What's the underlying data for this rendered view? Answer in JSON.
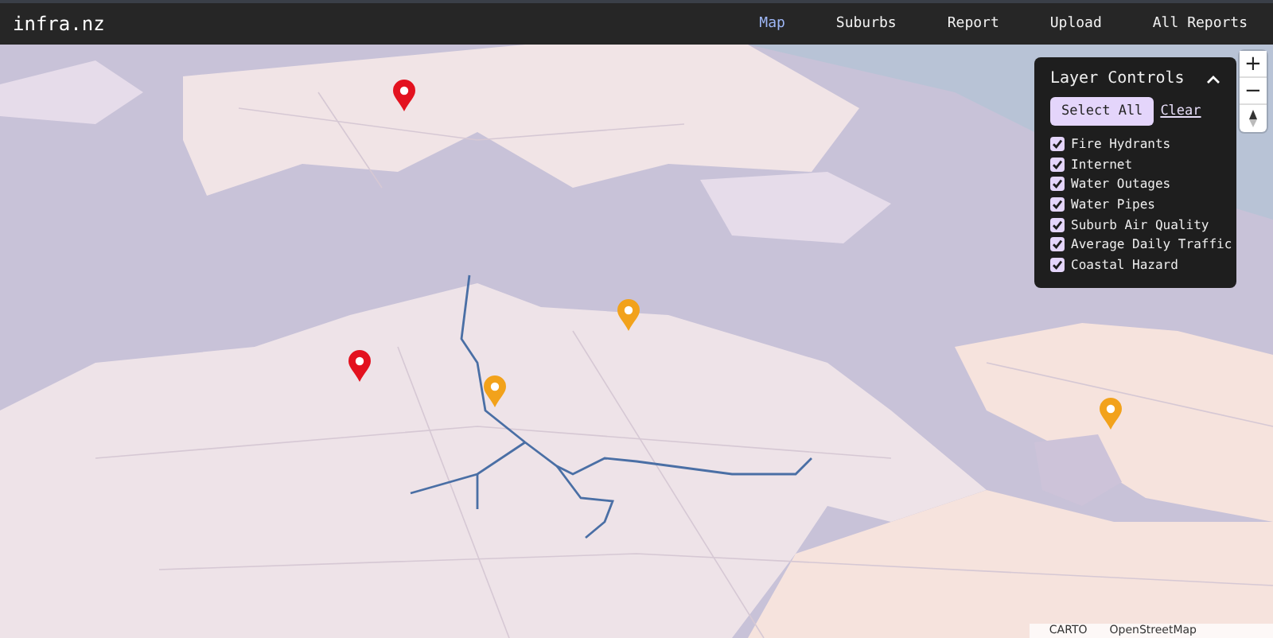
{
  "app": {
    "brand": "infra.nz"
  },
  "nav": [
    {
      "label": "Map",
      "selected": true
    },
    {
      "label": "Suburbs",
      "selected": false
    },
    {
      "label": "Report",
      "selected": false
    },
    {
      "label": "Upload",
      "selected": false
    },
    {
      "label": "All Reports",
      "selected": false
    }
  ],
  "map": {
    "markers": [
      {
        "color": "#e3121f"
      },
      {
        "color": "#e3121f"
      },
      {
        "color": "#f2a21b"
      },
      {
        "color": "#f2a21b"
      },
      {
        "color": "#f2a21b"
      }
    ],
    "zoom_in": "+",
    "zoom_out": "−",
    "attribution": [
      "CARTO",
      "OpenStreetMap"
    ]
  },
  "layer_controls": {
    "title": "Layer Controls",
    "expanded": true,
    "select_all": "Select All",
    "clear": "Clear",
    "layers": [
      {
        "label": "Fire Hydrants",
        "checked": true
      },
      {
        "label": "Internet",
        "checked": true
      },
      {
        "label": "Water Outages",
        "checked": true
      },
      {
        "label": "Water Pipes",
        "checked": true
      },
      {
        "label": "Suburb Air Quality",
        "checked": true
      },
      {
        "label": "Average Daily Traffic",
        "checked": true
      },
      {
        "label": "Coastal Hazard",
        "checked": true
      }
    ]
  }
}
